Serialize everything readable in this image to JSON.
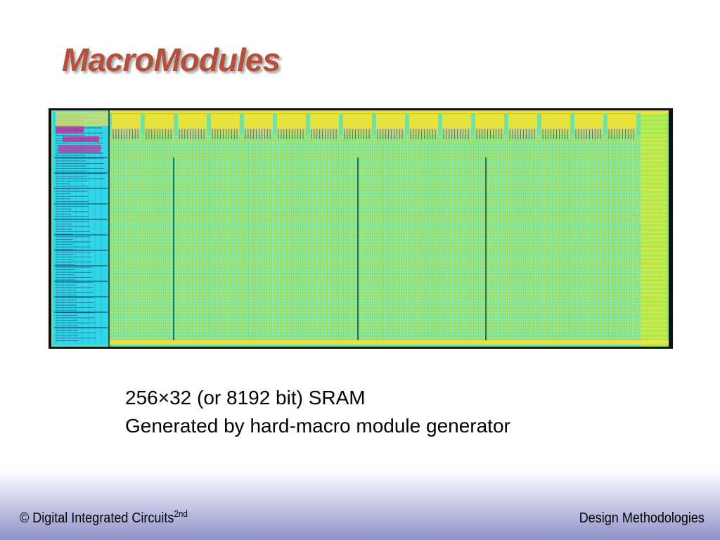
{
  "slide": {
    "title": "MacroModules",
    "caption_line1": "256×32 (or 8192 bit) SRAM",
    "caption_line2": "Generated by hard-macro module generator"
  },
  "footer": {
    "left_text": "© Digital Integrated Circuits",
    "left_superscript": "2nd",
    "right_text": "Design Methodologies"
  },
  "colors": {
    "title": "#b5503a",
    "array_fill": "#6fe3a6",
    "grid_yellow": "#e8e23a",
    "decoder_cyan": "#2fd7e8",
    "decoder_magenta": "#c0339a",
    "frame": "#101010",
    "footer_gradient_bottom": "#8d90c8"
  },
  "figure": {
    "icon": "sram-layout-image",
    "bit_columns": 16
  }
}
